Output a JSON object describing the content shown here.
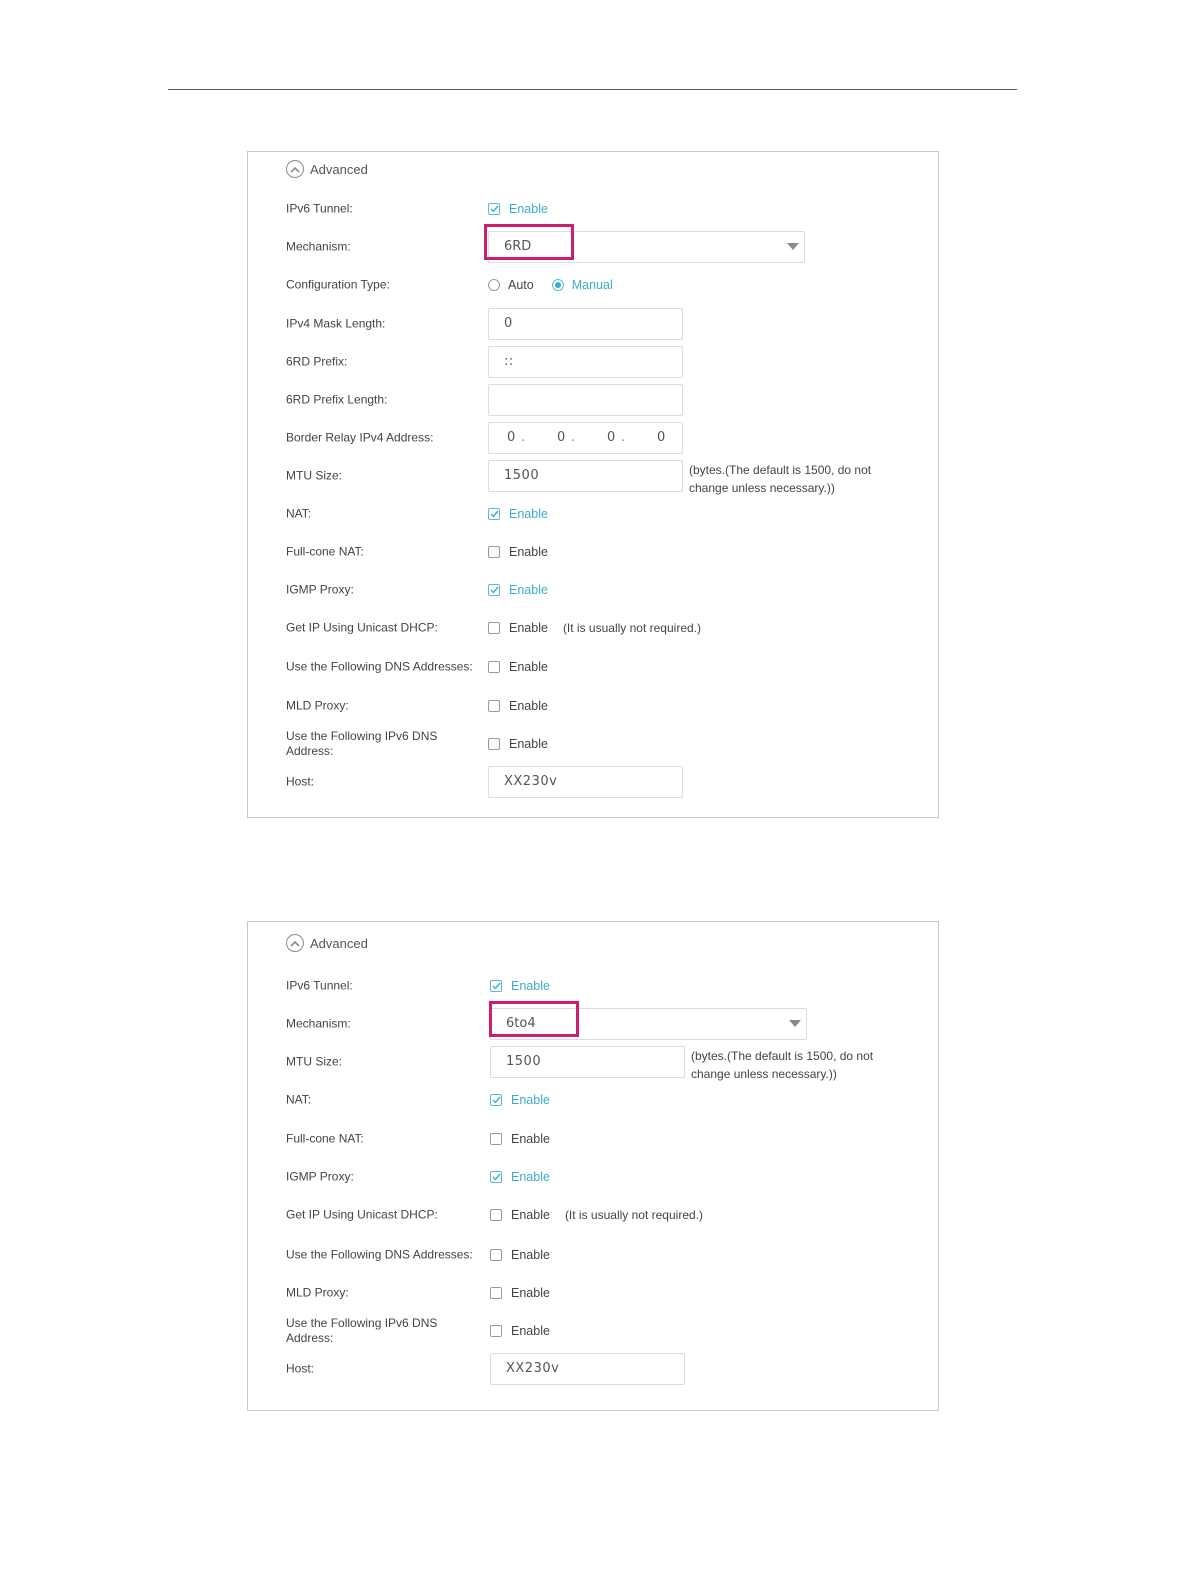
{
  "panel1": {
    "advanced": "Advanced",
    "ipv6_tunnel": {
      "label": "IPv6 Tunnel:",
      "option": "Enable",
      "checked": true
    },
    "mechanism": {
      "label": "Mechanism:",
      "value": "6RD"
    },
    "config_type": {
      "label": "Configuration Type:",
      "auto": "Auto",
      "manual": "Manual",
      "selected": "Manual"
    },
    "ipv4_mask": {
      "label": "IPv4 Mask Length:",
      "value": "0"
    },
    "prefix": {
      "label": "6RD Prefix:",
      "value": "::"
    },
    "prefix_length": {
      "label": "6RD Prefix Length:",
      "value": ""
    },
    "border_relay": {
      "label": "Border Relay IPv4 Address:",
      "octets": [
        "0",
        "0",
        "0",
        "0"
      ]
    },
    "mtu": {
      "label": "MTU Size:",
      "value": "1500",
      "help": "(bytes.(The default is 1500, do not change unless necessary.))"
    },
    "nat": {
      "label": "NAT:",
      "option": "Enable",
      "checked": true
    },
    "fullcone": {
      "label": "Full-cone NAT:",
      "option": "Enable",
      "checked": false
    },
    "igmp": {
      "label": "IGMP Proxy:",
      "option": "Enable",
      "checked": true
    },
    "unicast": {
      "label": "Get IP Using Unicast DHCP:",
      "option": "Enable",
      "note": "(It is usually not required.)",
      "checked": false
    },
    "dns": {
      "label": "Use the Following DNS Addresses:",
      "option": "Enable",
      "checked": false
    },
    "mld": {
      "label": "MLD Proxy:",
      "option": "Enable",
      "checked": false
    },
    "ipv6dns": {
      "label": "Use the Following IPv6 DNS Address:",
      "option": "Enable",
      "checked": false
    },
    "host": {
      "label": "Host:",
      "value": "XX230v"
    }
  },
  "panel2": {
    "advanced": "Advanced",
    "ipv6_tunnel": {
      "label": "IPv6 Tunnel:",
      "option": "Enable",
      "checked": true
    },
    "mechanism": {
      "label": "Mechanism:",
      "value": "6to4"
    },
    "mtu": {
      "label": "MTU Size:",
      "value": "1500",
      "help": "(bytes.(The default is 1500, do not change unless necessary.))"
    },
    "nat": {
      "label": "NAT:",
      "option": "Enable",
      "checked": true
    },
    "fullcone": {
      "label": "Full-cone NAT:",
      "option": "Enable",
      "checked": false
    },
    "igmp": {
      "label": "IGMP Proxy:",
      "option": "Enable",
      "checked": true
    },
    "unicast": {
      "label": "Get IP Using Unicast DHCP:",
      "option": "Enable",
      "note": "(It is usually not required.)",
      "checked": false
    },
    "dns": {
      "label": "Use the Following DNS Addresses:",
      "option": "Enable",
      "checked": false
    },
    "mld": {
      "label": "MLD Proxy:",
      "option": "Enable",
      "checked": false
    },
    "ipv6dns": {
      "label": "Use the Following IPv6 DNS Address:",
      "option": "Enable",
      "checked": false
    },
    "host": {
      "label": "Host:",
      "value": "XX230v"
    }
  },
  "colors": {
    "accent": "#3aaecb",
    "highlight": "#c8206e",
    "border": "#c8c8c8"
  }
}
